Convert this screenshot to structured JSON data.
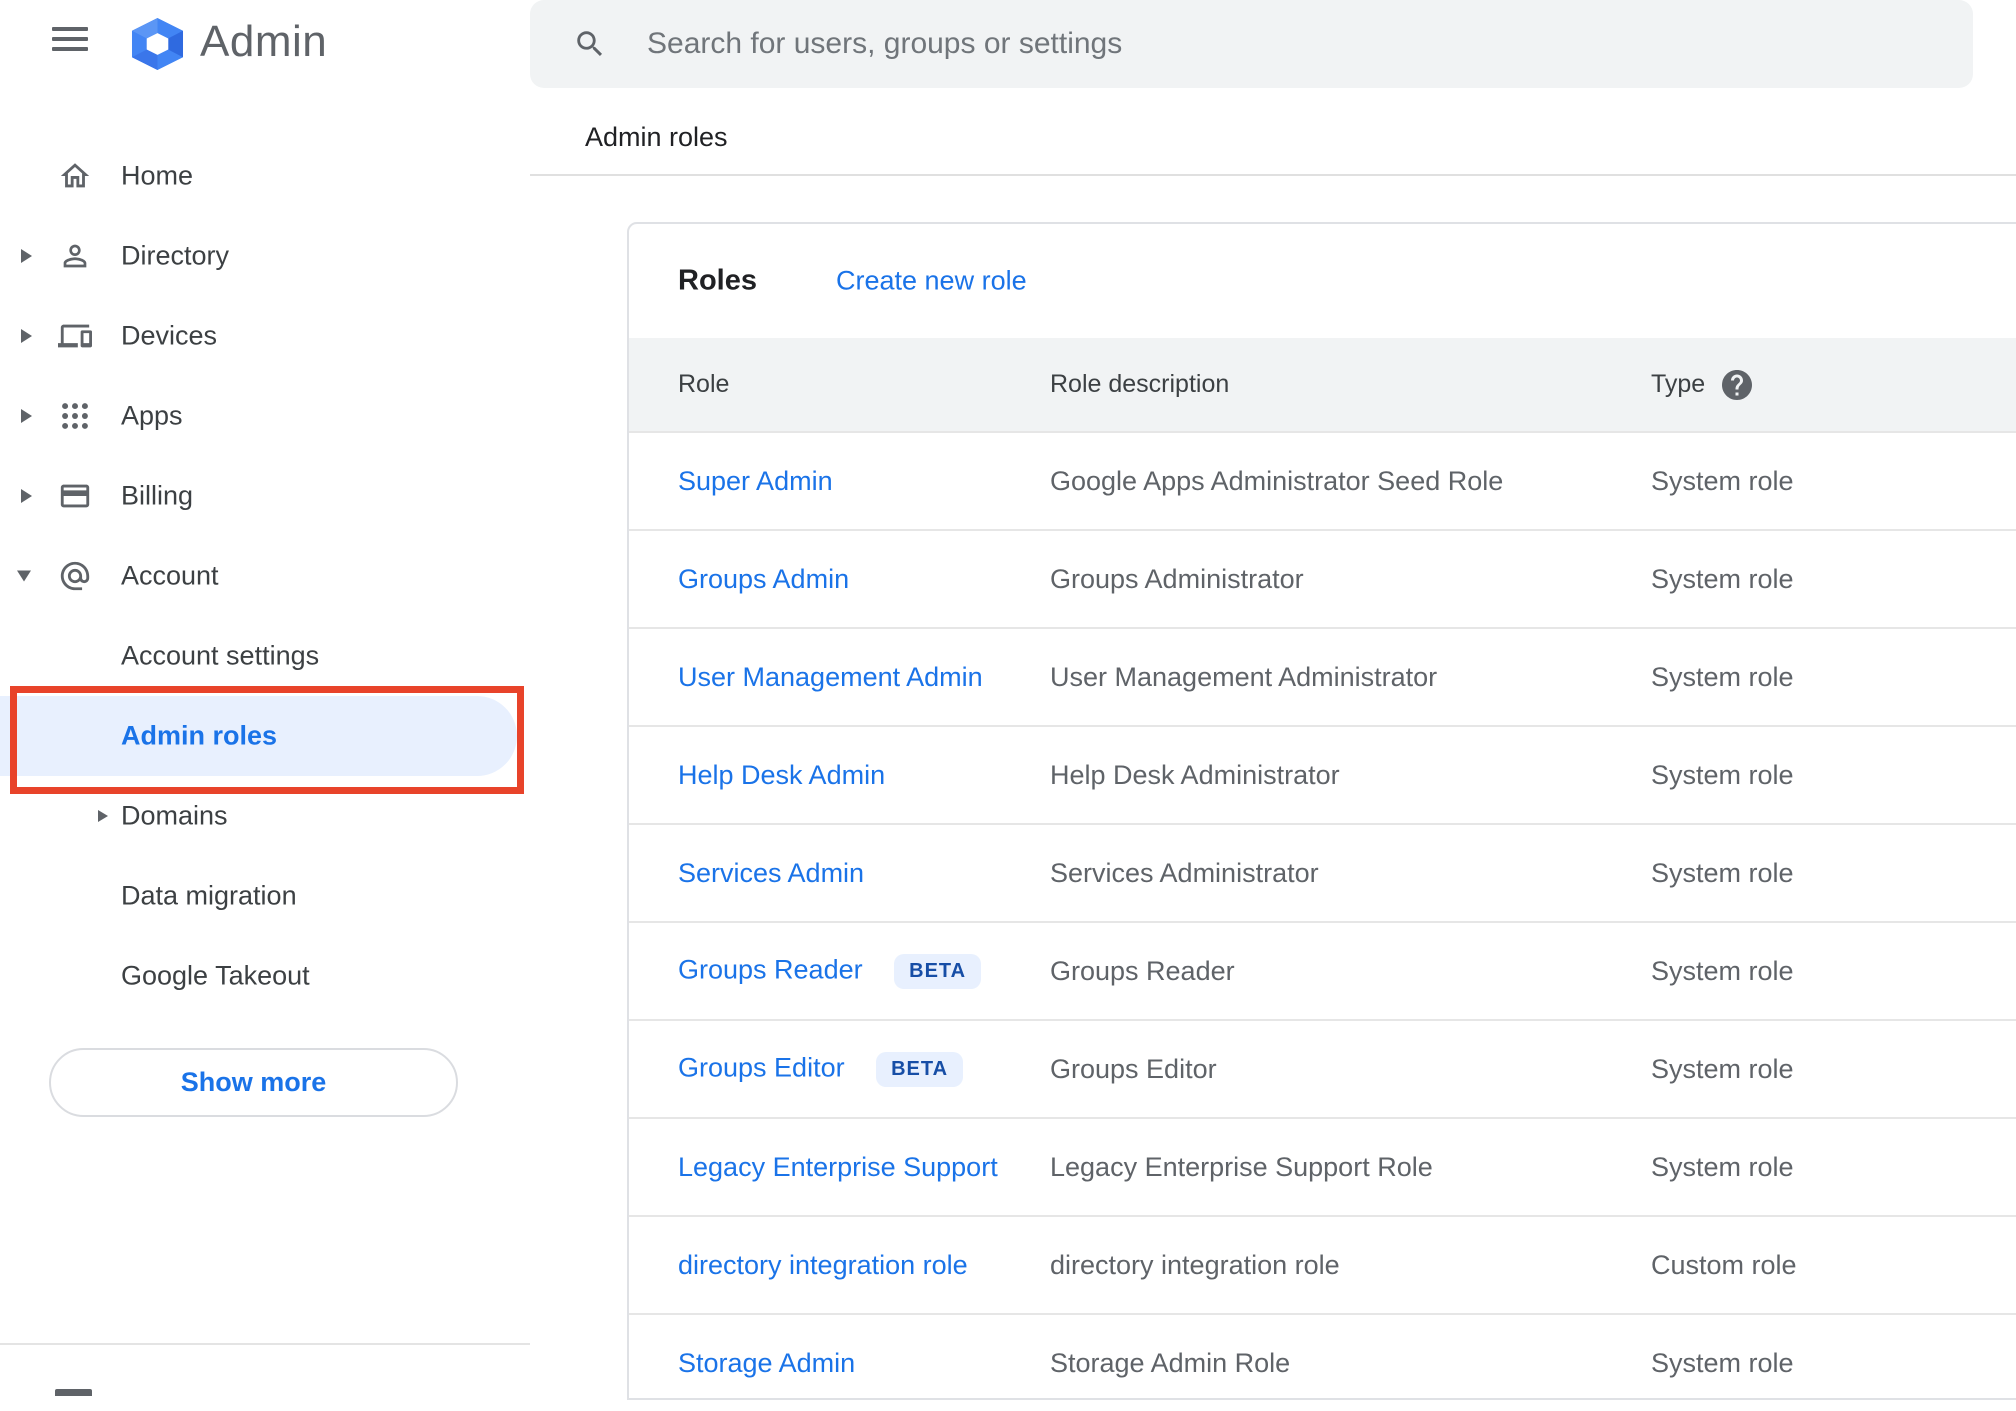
{
  "sidebar": {
    "logo_text": "Admin",
    "items": [
      {
        "label": "Home"
      },
      {
        "label": "Directory"
      },
      {
        "label": "Devices"
      },
      {
        "label": "Apps"
      },
      {
        "label": "Billing"
      },
      {
        "label": "Account"
      }
    ],
    "sub_items": [
      {
        "label": "Account settings"
      },
      {
        "label": "Admin roles",
        "active": true
      },
      {
        "label": "Domains"
      },
      {
        "label": "Data migration"
      },
      {
        "label": "Google Takeout"
      }
    ],
    "show_more_label": "Show more"
  },
  "search": {
    "placeholder": "Search for users, groups or settings"
  },
  "breadcrumb": "Admin roles",
  "roles_card": {
    "title": "Roles",
    "create_link": "Create new role",
    "columns": {
      "role": "Role",
      "description": "Role description",
      "type": "Type"
    },
    "beta_label": "BETA",
    "rows": [
      {
        "role": "Super Admin",
        "description": "Google Apps Administrator Seed Role",
        "type": "System role",
        "beta": false
      },
      {
        "role": "Groups Admin",
        "description": "Groups Administrator",
        "type": "System role",
        "beta": false
      },
      {
        "role": "User Management Admin",
        "description": "User Management Administrator",
        "type": "System role",
        "beta": false
      },
      {
        "role": "Help Desk Admin",
        "description": "Help Desk Administrator",
        "type": "System role",
        "beta": false
      },
      {
        "role": "Services Admin",
        "description": "Services Administrator",
        "type": "System role",
        "beta": false
      },
      {
        "role": "Groups Reader",
        "description": "Groups Reader",
        "type": "System role",
        "beta": true
      },
      {
        "role": "Groups Editor",
        "description": "Groups Editor",
        "type": "System role",
        "beta": true
      },
      {
        "role": "Legacy Enterprise Support",
        "description": "Legacy Enterprise Support Role",
        "type": "System role",
        "beta": false
      },
      {
        "role": "directory integration role",
        "description": "directory integration role",
        "type": "Custom role",
        "beta": false
      },
      {
        "role": "Storage Admin",
        "description": "Storage Admin Role",
        "type": "System role",
        "beta": false
      }
    ]
  },
  "colors": {
    "accent_blue": "#1a73e8",
    "active_pill_bg": "#e8f0fe",
    "annotation_red": "#e8432a",
    "beta_text": "#174ea6",
    "beta_bg": "#e8f0fe",
    "header_row_bg": "#f1f3f4",
    "search_bg": "#f1f3f4",
    "text_dark": "#202124",
    "text_gray": "#5f6368",
    "logo_blue": "#4285f4"
  }
}
